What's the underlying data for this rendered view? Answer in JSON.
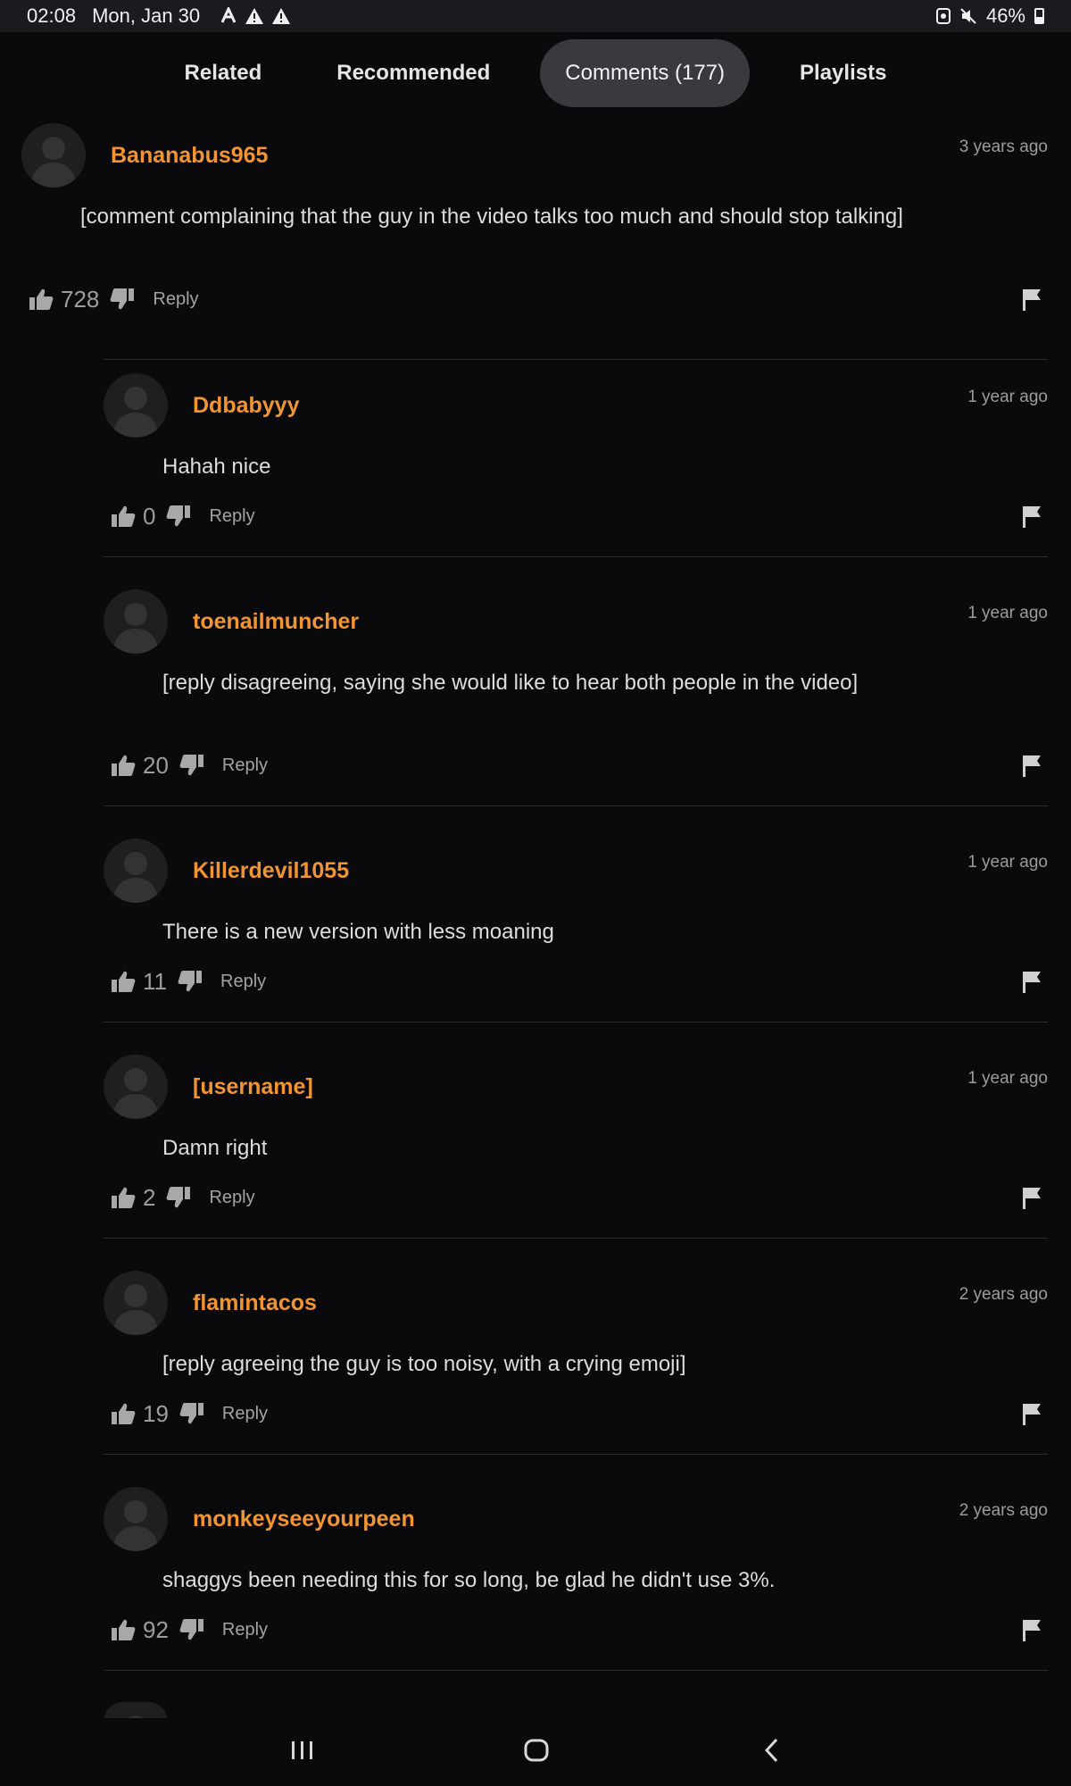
{
  "status_bar": {
    "time": "02:08",
    "date": "Mon, Jan 30",
    "battery": "46%",
    "battery_level": 0.46,
    "left_icons": [
      "font-a-icon",
      "warning-icon",
      "warning-icon"
    ],
    "right_icons": [
      "nfc-icon",
      "mute-icon",
      "battery-icon"
    ]
  },
  "tabs": [
    {
      "label": "Related",
      "active": false
    },
    {
      "label": "Recommended",
      "active": false
    },
    {
      "label": "Comments (177)",
      "active": true
    },
    {
      "label": "Playlists",
      "active": false
    }
  ],
  "reply_label": "Reply",
  "colors": {
    "background": "#0a090c",
    "username": "#f19432",
    "active_tab": "#3a393d",
    "text": "#dddddd",
    "muted": "#9c9c9c"
  },
  "comments": [
    {
      "username": "Bananabus965",
      "time": "3 years ago",
      "body": "[comment complaining that the guy in the video talks too much and should stop talking]",
      "likes": "728",
      "is_reply": false
    },
    {
      "username": "Ddbabyyy",
      "time": "1 year ago",
      "body": "Hahah nice",
      "likes": "0",
      "is_reply": true
    },
    {
      "username": "toenailmuncher",
      "time": "1 year ago",
      "body": "[reply disagreeing, saying she would like to hear both people in the video]",
      "likes": "20",
      "is_reply": true
    },
    {
      "username": "Killerdevil1055",
      "time": "1 year ago",
      "body": "There is a new version with less moaning",
      "likes": "11",
      "is_reply": true
    },
    {
      "username": "[username]",
      "time": "1 year ago",
      "body": "Damn right",
      "likes": "2",
      "is_reply": true
    },
    {
      "username": "flamintacos",
      "time": "2 years ago",
      "body": "[reply agreeing the guy is too noisy, with a crying emoji]",
      "likes": "19",
      "is_reply": true
    },
    {
      "username": "monkeyseeyourpeen",
      "time": "2 years ago",
      "body": "shaggys been needing this for so long, be glad he didn't use 3%.",
      "likes": "92",
      "is_reply": true
    }
  ]
}
